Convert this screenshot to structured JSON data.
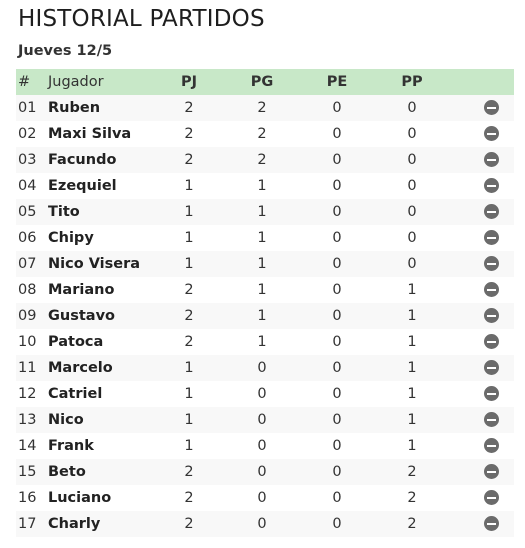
{
  "page": {
    "title": "HISTORIAL PARTIDOS",
    "subtitle": "Jueves 12/5"
  },
  "table": {
    "headers": {
      "num": "#",
      "name": "Jugador",
      "pj": "PJ",
      "pg": "PG",
      "pe": "PE",
      "pp": "PP"
    },
    "row_action_icon": "remove-circle-icon",
    "header_color": "#c8e8c8",
    "rows": [
      {
        "num": "01",
        "name": "Ruben",
        "pj": "2",
        "pg": "2",
        "pe": "0",
        "pp": "0"
      },
      {
        "num": "02",
        "name": "Maxi Silva",
        "pj": "2",
        "pg": "2",
        "pe": "0",
        "pp": "0"
      },
      {
        "num": "03",
        "name": "Facundo",
        "pj": "2",
        "pg": "2",
        "pe": "0",
        "pp": "0"
      },
      {
        "num": "04",
        "name": "Ezequiel",
        "pj": "1",
        "pg": "1",
        "pe": "0",
        "pp": "0"
      },
      {
        "num": "05",
        "name": "Tito",
        "pj": "1",
        "pg": "1",
        "pe": "0",
        "pp": "0"
      },
      {
        "num": "06",
        "name": "Chipy",
        "pj": "1",
        "pg": "1",
        "pe": "0",
        "pp": "0"
      },
      {
        "num": "07",
        "name": "Nico Visera",
        "pj": "1",
        "pg": "1",
        "pe": "0",
        "pp": "0"
      },
      {
        "num": "08",
        "name": "Mariano",
        "pj": "2",
        "pg": "1",
        "pe": "0",
        "pp": "1"
      },
      {
        "num": "09",
        "name": "Gustavo",
        "pj": "2",
        "pg": "1",
        "pe": "0",
        "pp": "1"
      },
      {
        "num": "10",
        "name": "Patoca",
        "pj": "2",
        "pg": "1",
        "pe": "0",
        "pp": "1"
      },
      {
        "num": "11",
        "name": "Marcelo",
        "pj": "1",
        "pg": "0",
        "pe": "0",
        "pp": "1"
      },
      {
        "num": "12",
        "name": "Catriel",
        "pj": "1",
        "pg": "0",
        "pe": "0",
        "pp": "1"
      },
      {
        "num": "13",
        "name": "Nico",
        "pj": "1",
        "pg": "0",
        "pe": "0",
        "pp": "1"
      },
      {
        "num": "14",
        "name": "Frank",
        "pj": "1",
        "pg": "0",
        "pe": "0",
        "pp": "1"
      },
      {
        "num": "15",
        "name": "Beto",
        "pj": "2",
        "pg": "0",
        "pe": "0",
        "pp": "2"
      },
      {
        "num": "16",
        "name": "Luciano",
        "pj": "2",
        "pg": "0",
        "pe": "0",
        "pp": "2"
      },
      {
        "num": "17",
        "name": "Charly",
        "pj": "2",
        "pg": "0",
        "pe": "0",
        "pp": "2"
      }
    ]
  }
}
